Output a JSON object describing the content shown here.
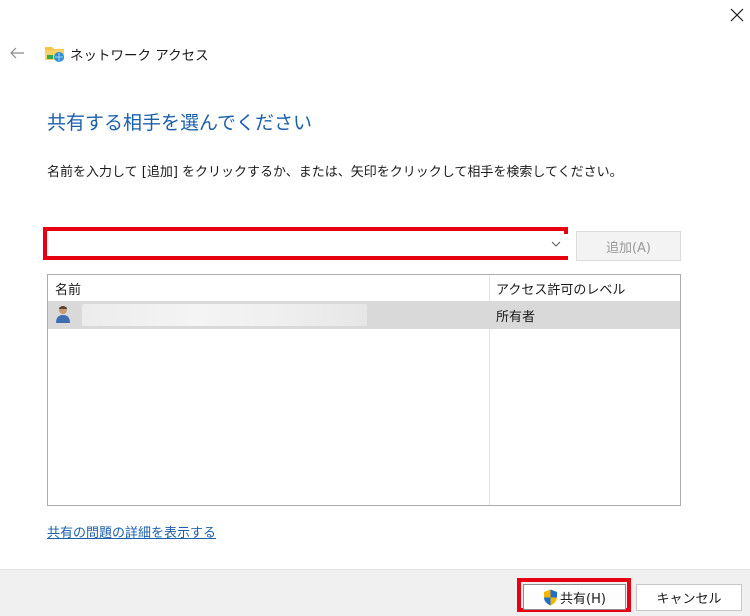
{
  "window": {
    "title": "ネットワーク アクセス",
    "back_icon": "arrow-left-icon",
    "close_icon": "close-icon",
    "folder_icon": "network-folder-icon"
  },
  "main": {
    "heading": "共有する相手を選んでください",
    "instruction": "名前を入力して [追加] をクリックするか、または、矢印をクリックして相手を検索してください。",
    "combo": {
      "value": "",
      "dropdown_icon": "chevron-down-icon"
    },
    "add_button": "追加(A)",
    "list": {
      "columns": [
        "名前",
        "アクセス許可のレベル"
      ],
      "rows": [
        {
          "name": "",
          "level": "所有者",
          "icon": "user-icon"
        }
      ]
    },
    "details_link": "共有の問題の詳細を表示する"
  },
  "footer": {
    "share_button": "共有(H)",
    "share_icon": "uac-shield-icon",
    "cancel_button": "キャンセル"
  },
  "colors": {
    "heading": "#1b5fab",
    "highlight": "#e60012",
    "selected_row": "#d9d9d9"
  }
}
